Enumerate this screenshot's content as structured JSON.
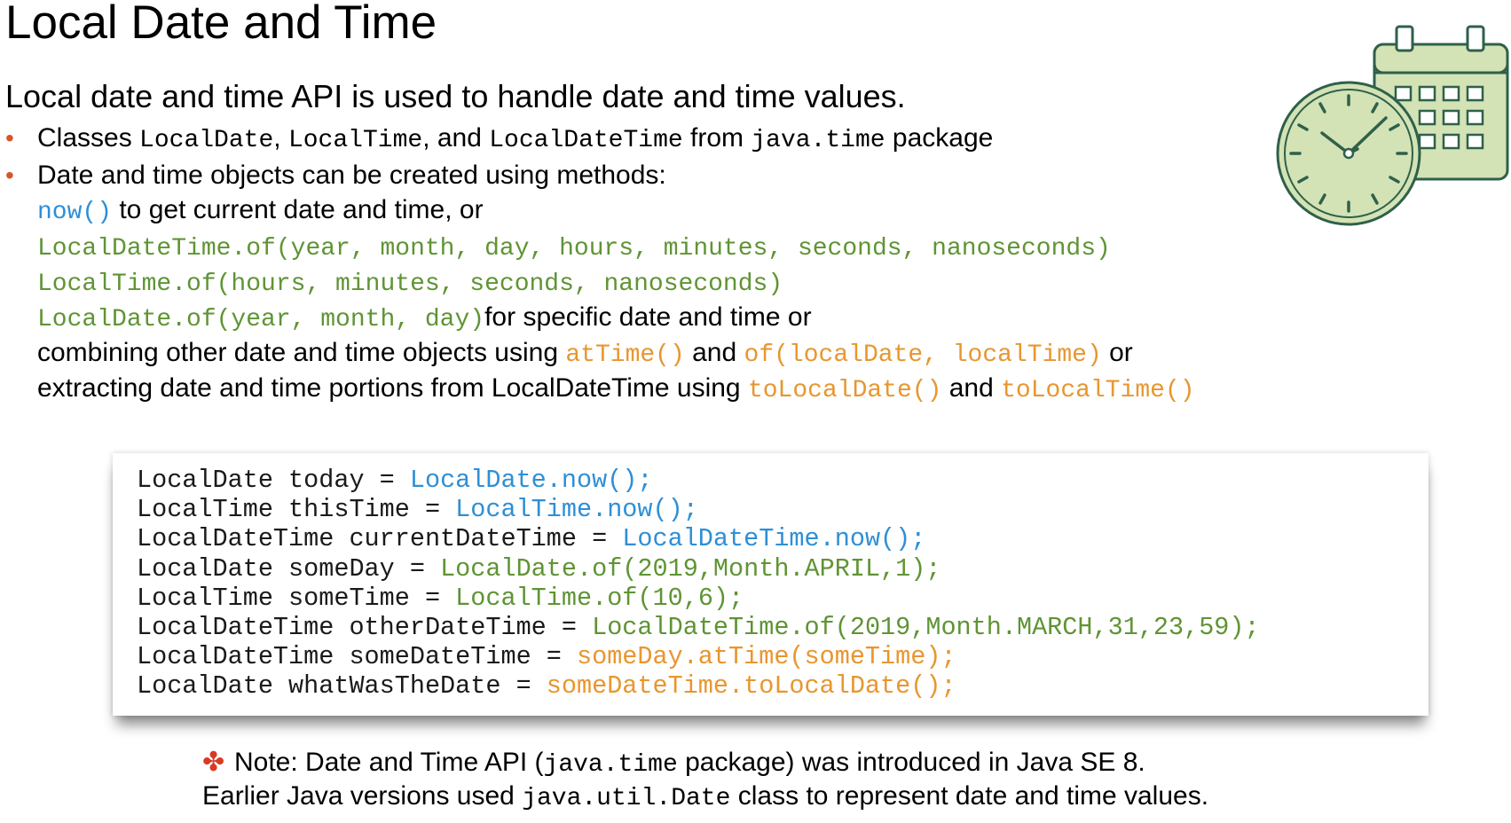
{
  "title": "Local Date and Time",
  "subtitle": "Local date and time API is used to handle date and time values.",
  "bullet1": {
    "t1": "Classes ",
    "c1": "LocalDate",
    "t2": ", ",
    "c2": "LocalTime",
    "t3": ", and ",
    "c3": "LocalDateTime",
    "t4": " from ",
    "c4": "java.time",
    "t5": " package"
  },
  "bullet2": {
    "text": "Date and time objects can be created using methods:"
  },
  "now_line": {
    "code": "now()",
    "text": " to get current date and time, or"
  },
  "of_lines": {
    "datetime": "LocalDateTime.of(year, month, day, hours, minutes, seconds, nanoseconds)",
    "time": "LocalTime.of(hours, minutes, seconds, nanoseconds)",
    "date": "LocalDate.of(year, month, day)",
    "date_suffix": "for specific date and time or"
  },
  "combine_line": {
    "t1": "combining other date and time objects using ",
    "c1": "atTime()",
    "t2": " and ",
    "c2": "of(localDate, localTime)",
    "t3": " or"
  },
  "extract_line": {
    "t1": "extracting date and time portions from LocalDateTime using ",
    "c1": "toLocalDate()",
    "t2": " and ",
    "c2": "toLocalTime()"
  },
  "code": [
    {
      "plain": "LocalDate today = ",
      "hl": "LocalDate.now();"
    },
    {
      "plain": "LocalTime thisTime = ",
      "hl": "LocalTime.now();"
    },
    {
      "plain": "LocalDateTime currentDateTime = ",
      "hl": "LocalDateTime.now();"
    },
    {
      "plain": "LocalDate someDay = ",
      "hl": "LocalDate.of(2019,Month.APRIL,1);"
    },
    {
      "plain": "LocalTime someTime = ",
      "hl": "LocalTime.of(10,6);"
    },
    {
      "plain": "LocalDateTime otherDateTime = ",
      "hl": "LocalDateTime.of(2019,Month.MARCH,31,23,59);"
    },
    {
      "plain": "LocalDateTime someDateTime = ",
      "hl": "someDay.atTime(someTime);"
    },
    {
      "plain": "LocalDate whatWasTheDate = ",
      "hl": "someDateTime.toLocalDate();"
    }
  ],
  "note": {
    "icon": "note-star-icon",
    "t1": "Note: Date and Time API (",
    "c1": "java.time",
    "t2": " package) was introduced in Java SE 8.",
    "t3": "Earlier Java versions used ",
    "c2": "java.util.Date",
    "t4": " class to represent date and time values."
  },
  "colors": {
    "blue": "#2e8fd6",
    "green": "#5f9434",
    "orange": "#e8962f",
    "bullet": "#d9542b",
    "note_icon": "#d83a26",
    "illustration_stroke": "#2f6049",
    "illustration_fill": "#d3e3b6"
  }
}
